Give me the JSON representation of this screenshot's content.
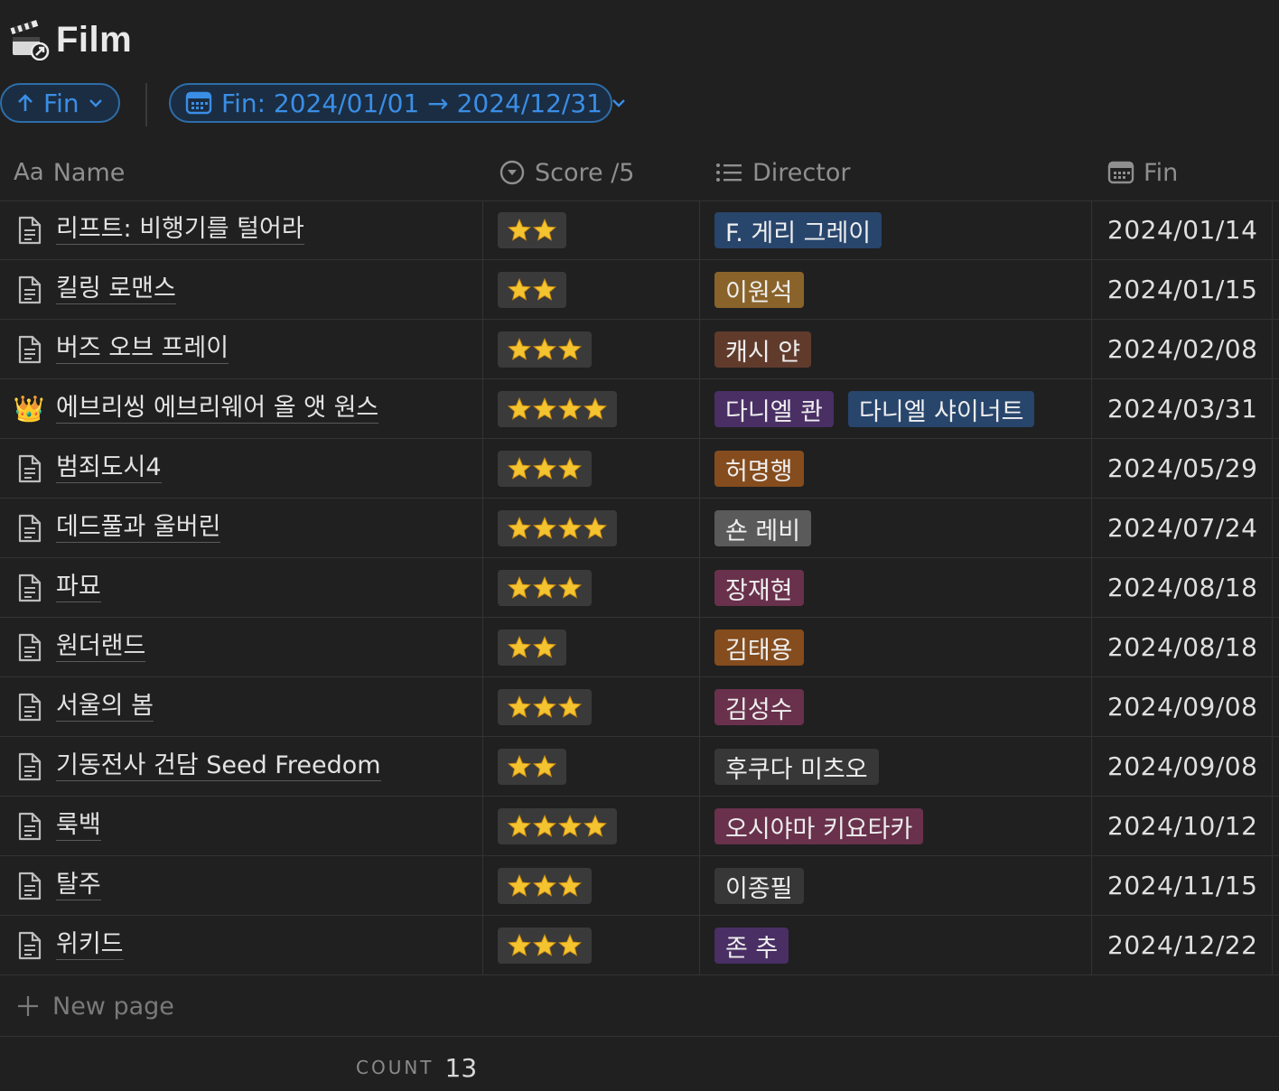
{
  "page": {
    "title": "Film",
    "icon": "clapperboard-icon"
  },
  "toolbar": {
    "sort": {
      "label": "Fin",
      "icon": "arrow-up-icon"
    },
    "filter": {
      "label": "Fin: 2024/01/01 → 2024/12/31",
      "icon": "calendar-icon"
    }
  },
  "columns": {
    "name": {
      "label": "Name",
      "prefix": "Aa"
    },
    "score": {
      "label": "Score /5",
      "icon": "select-icon"
    },
    "director": {
      "label": "Director",
      "icon": "list-icon"
    },
    "fin": {
      "label": "Fin",
      "icon": "calendar-icon"
    }
  },
  "rows": [
    {
      "name": "리프트: 비행기를 털어라",
      "icon": "document-icon",
      "stars": 2,
      "directors": [
        {
          "name": "F. 게리 그레이",
          "color": "#28456c"
        }
      ],
      "fin": "2024/01/14"
    },
    {
      "name": "킬링 로맨스",
      "icon": "document-icon",
      "stars": 2,
      "directors": [
        {
          "name": "이원석",
          "color": "#89632a"
        }
      ],
      "fin": "2024/01/15"
    },
    {
      "name": "버즈 오브 프레이",
      "icon": "document-icon",
      "stars": 3,
      "directors": [
        {
          "name": "캐시 얀",
          "color": "#603b2c"
        }
      ],
      "fin": "2024/02/08"
    },
    {
      "name": "에브리씽 에브리웨어 올 앳 원스",
      "icon": "crown-icon",
      "stars": 4,
      "directors": [
        {
          "name": "다니엘 콴",
          "color": "#492f64"
        },
        {
          "name": "다니엘 샤이너트",
          "color": "#28456c"
        }
      ],
      "fin": "2024/03/31"
    },
    {
      "name": "범죄도시4",
      "icon": "document-icon",
      "stars": 3,
      "directors": [
        {
          "name": "허명행",
          "color": "#854c1d"
        }
      ],
      "fin": "2024/05/29"
    },
    {
      "name": "데드풀과 울버린",
      "icon": "document-icon",
      "stars": 4,
      "directors": [
        {
          "name": "숀 레비",
          "color": "#5a5a5a"
        }
      ],
      "fin": "2024/07/24"
    },
    {
      "name": "파묘",
      "icon": "document-icon",
      "stars": 3,
      "directors": [
        {
          "name": "장재현",
          "color": "#69314c"
        }
      ],
      "fin": "2024/08/18"
    },
    {
      "name": "원더랜드",
      "icon": "document-icon",
      "stars": 2,
      "directors": [
        {
          "name": "김태용",
          "color": "#854c1d"
        }
      ],
      "fin": "2024/08/18"
    },
    {
      "name": "서울의 봄",
      "icon": "document-icon",
      "stars": 3,
      "directors": [
        {
          "name": "김성수",
          "color": "#69314c"
        }
      ],
      "fin": "2024/09/08"
    },
    {
      "name": "기동전사 건담 Seed Freedom",
      "icon": "document-icon",
      "stars": 2,
      "directors": [
        {
          "name": "후쿠다 미츠오",
          "color": "#373737"
        }
      ],
      "fin": "2024/09/08"
    },
    {
      "name": "룩백",
      "icon": "document-icon",
      "stars": 4,
      "directors": [
        {
          "name": "오시야마 키요타카",
          "color": "#69314c"
        }
      ],
      "fin": "2024/10/12"
    },
    {
      "name": "탈주",
      "icon": "document-icon",
      "stars": 3,
      "directors": [
        {
          "name": "이종필",
          "color": "#373737"
        }
      ],
      "fin": "2024/11/15"
    },
    {
      "name": "위키드",
      "icon": "document-icon",
      "stars": 3,
      "directors": [
        {
          "name": "존 추",
          "color": "#492f64"
        }
      ],
      "fin": "2024/12/22"
    }
  ],
  "new_page": {
    "label": "New page",
    "icon": "plus-icon"
  },
  "footer": {
    "count_label": "COUNT",
    "count_value": "13"
  },
  "colors": {
    "accent": "#3a8ee6",
    "background": "#202020",
    "star": "#f4c430"
  }
}
